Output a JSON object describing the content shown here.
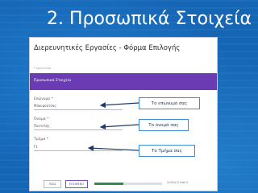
{
  "slide": {
    "title": "2. Προσωπικά Στοιχεία"
  },
  "form": {
    "title": "Διερευνητικές Εργασίες - Φόρμα Επιλογής",
    "required_note": "* Απαιτείται",
    "section_title": "Προσωπικά Στοιχεία",
    "fields": [
      {
        "label": "Επώνυμο",
        "required_mark": "*",
        "value": "Μπουρούτσας"
      },
      {
        "label": "Όνομα",
        "required_mark": "*",
        "value": "Παντελής"
      },
      {
        "label": "Τμήμα",
        "required_mark": "*",
        "value": "Γ1"
      }
    ],
    "back_label": "ΠΙΣΩ",
    "next_label": "ΕΠΟΜΕΝΟ",
    "progress_fraction": 0.43,
    "page_text": "Σελίδα 2 από 5"
  },
  "annotations": [
    {
      "text": "Το επώνυμό σας"
    },
    {
      "text": "Το όνομά σας"
    },
    {
      "text": "Το Τμήμα σας"
    }
  ],
  "colors": {
    "slide_background": "#1565b5",
    "section_bar": "#6b3bb3",
    "annotation_border": "#3a8ed8",
    "progress_fill": "#2f8c4a"
  }
}
